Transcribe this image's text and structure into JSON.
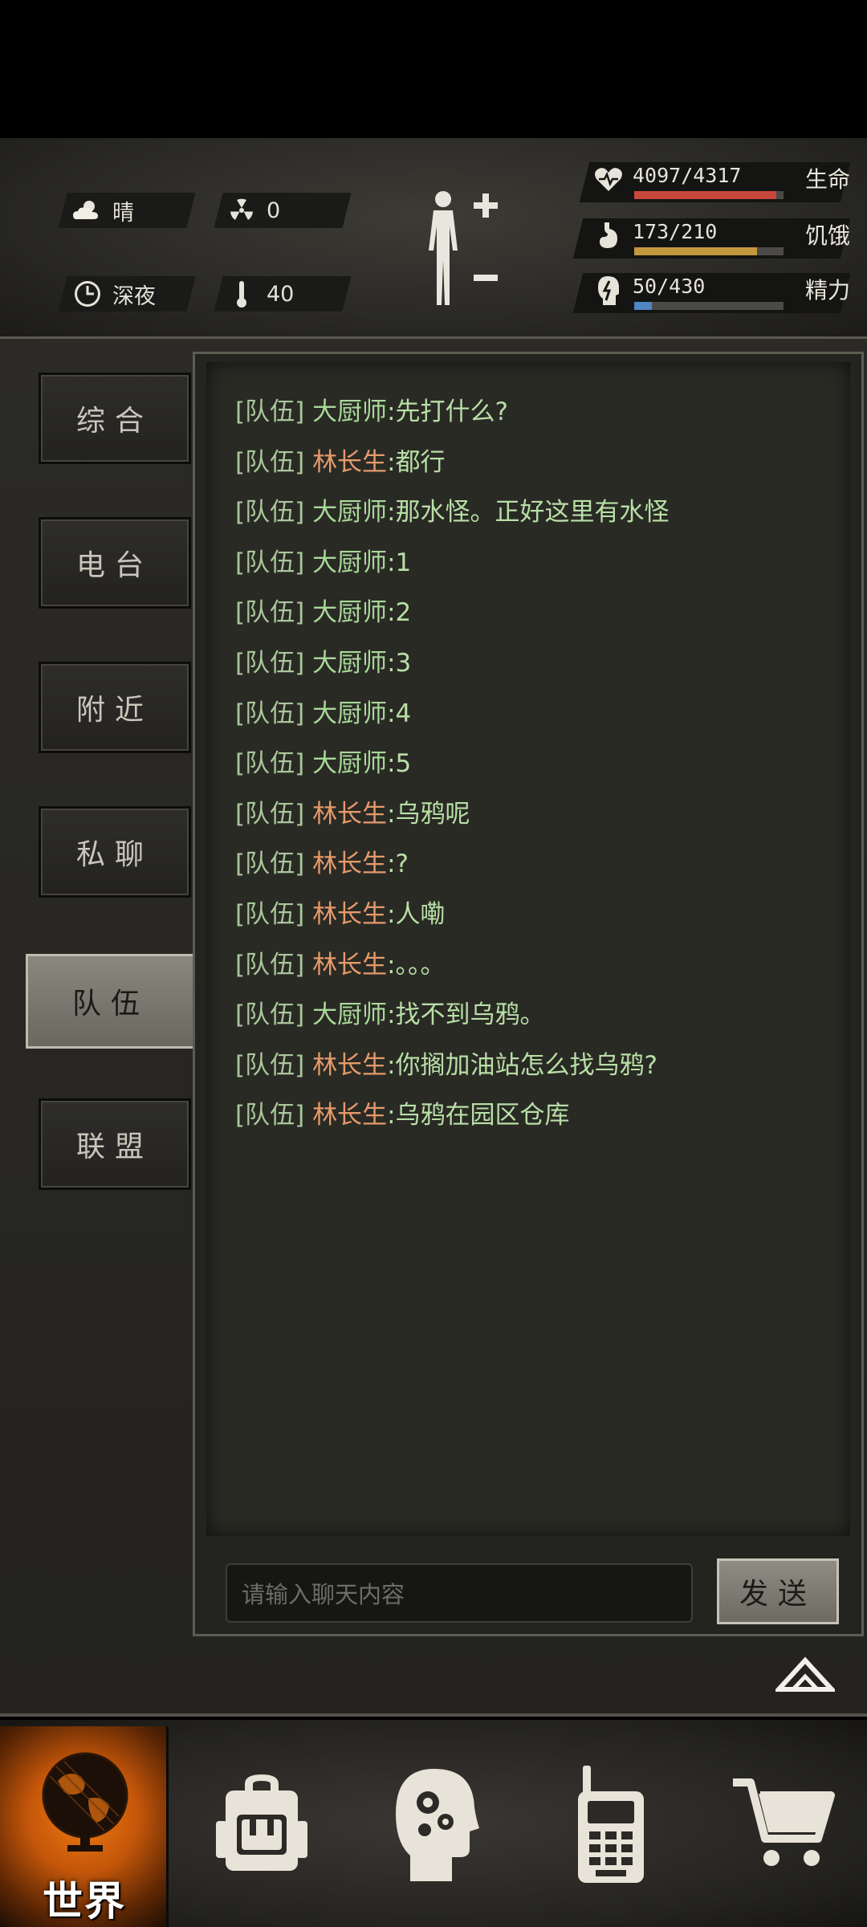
{
  "status": {
    "weather": "晴",
    "radiation": "0",
    "time_of_day": "深夜",
    "temperature": "40",
    "health": {
      "value": "4097/4317",
      "label": "生命",
      "fraction": 0.949,
      "color": "#c8473b"
    },
    "hunger": {
      "value": "173/210",
      "label": "饥饿",
      "fraction": 0.824,
      "color": "#c4983c"
    },
    "energy": {
      "value": "50/430",
      "label": "精力",
      "fraction": 0.116,
      "color": "#4f86c4"
    }
  },
  "tabs": [
    {
      "label": "综合"
    },
    {
      "label": "电台"
    },
    {
      "label": "附近"
    },
    {
      "label": "私聊"
    },
    {
      "label": "队伍",
      "active": true
    },
    {
      "label": "联盟"
    }
  ],
  "chat": {
    "messages": [
      {
        "tag": "[队伍]",
        "name": "大厨师",
        "text": ":先打什么?",
        "who": "a"
      },
      {
        "tag": "[队伍]",
        "name": "林长生",
        "text": ":都行",
        "who": "b"
      },
      {
        "tag": "[队伍]",
        "name": "大厨师",
        "text": ":那水怪。正好这里有水怪",
        "who": "a"
      },
      {
        "tag": "[队伍]",
        "name": "大厨师",
        "text": ":1",
        "who": "a"
      },
      {
        "tag": "[队伍]",
        "name": "大厨师",
        "text": ":2",
        "who": "a"
      },
      {
        "tag": "[队伍]",
        "name": "大厨师",
        "text": ":3",
        "who": "a"
      },
      {
        "tag": "[队伍]",
        "name": "大厨师",
        "text": ":4",
        "who": "a"
      },
      {
        "tag": "[队伍]",
        "name": "大厨师",
        "text": ":5",
        "who": "a"
      },
      {
        "tag": "[队伍]",
        "name": "林长生",
        "text": ":乌鸦呢",
        "who": "b"
      },
      {
        "tag": "[队伍]",
        "name": "林长生",
        "text": ":?",
        "who": "b"
      },
      {
        "tag": "[队伍]",
        "name": "林长生",
        "text": ":人嘞",
        "who": "b"
      },
      {
        "tag": "[队伍]",
        "name": "林长生",
        "text": ":。。。",
        "who": "b"
      },
      {
        "tag": "[队伍]",
        "name": "大厨师",
        "text": ":找不到乌鸦。",
        "who": "a"
      },
      {
        "tag": "[队伍]",
        "name": "林长生",
        "text": ":你搁加油站怎么找乌鸦?",
        "who": "b"
      },
      {
        "tag": "[队伍]",
        "name": "林长生",
        "text": ":乌鸦在园区仓库",
        "who": "b"
      }
    ],
    "input_placeholder": "请输入聊天内容",
    "send_label": "发送"
  },
  "nav": {
    "world_label": "世界",
    "items": [
      "backpack-icon",
      "skills-head-icon",
      "radio-walkie-icon",
      "shop-cart-icon"
    ]
  }
}
